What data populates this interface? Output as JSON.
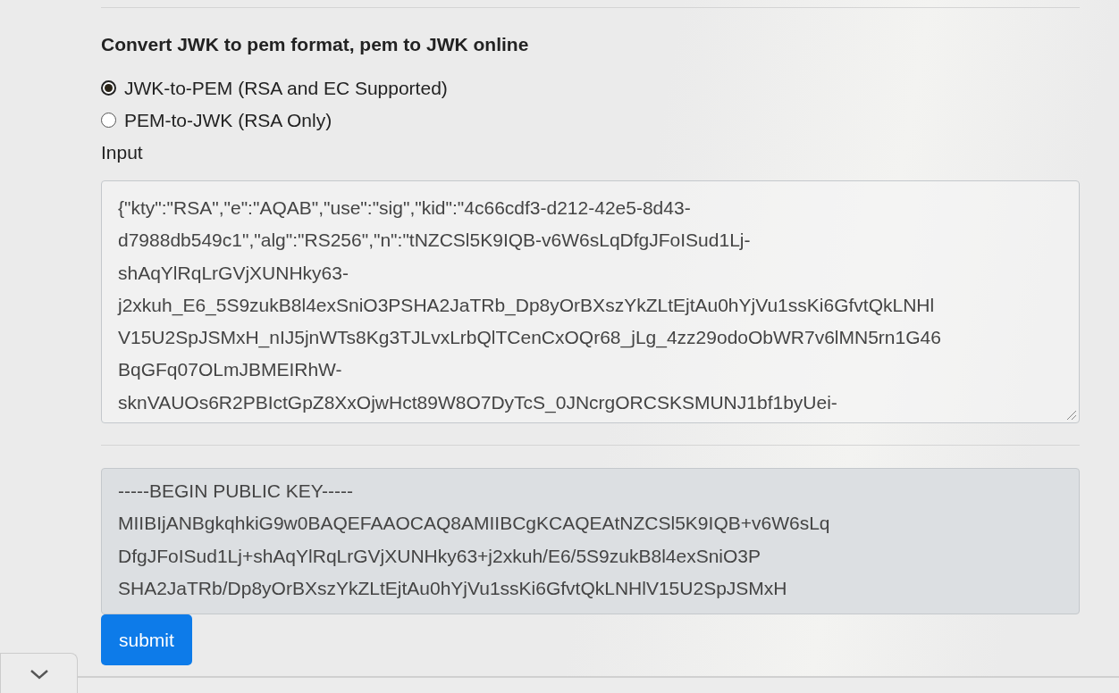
{
  "heading": "Convert JWK to pem format, pem to JWK online",
  "modes": [
    {
      "label": "JWK-to-PEM (RSA and EC Supported)",
      "selected": true
    },
    {
      "label": "PEM-to-JWK (RSA Only)",
      "selected": false
    }
  ],
  "input": {
    "label": "Input",
    "value": "{\"kty\":\"RSA\",\"e\":\"AQAB\",\"use\":\"sig\",\"kid\":\"4c66cdf3-d212-42e5-8d43-\nd7988db549c1\",\"alg\":\"RS256\",\"n\":\"tNZCSl5K9IQB-v6W6sLqDfgJFoISud1Lj-\nshAqYlRqLrGVjXUNHky63-\nj2xkuh_E6_5S9zukB8l4exSniO3PSHA2JaTRb_Dp8yOrBXszYkZLtEjtAu0hYjVu1ssKi6GfvtQkLNHl\nV15U2SpJSMxH_nIJ5jnWTs8Kg3TJLvxLrbQlTCenCxOQr68_jLg_4zz29odoObWR7v6lMN5rn1G46\nBqGFq07OLmJBMEIRhW-\nsknVAUOs6R2PBIctGpZ8XxOjwHct89W8O7DyTcS_0JNcrgORCSKSMUNJ1bf1byUei-"
  },
  "output": {
    "value": "-----BEGIN PUBLIC KEY-----\nMIIBIjANBgkqhkiG9w0BAQEFAAOCAQ8AMIIBCgKCAQEAtNZCSl5K9IQB+v6W6sLq\nDfgJFoISud1Lj+shAqYlRqLrGVjXUNHky63+j2xkuh/E6/5S9zukB8l4exSniO3P\nSHA2JaTRb/Dp8yOrBXszYkZLtEjtAu0hYjVu1ssKi6GfvtQkLNHlV15U2SpJSMxH",
    "disabled": true
  },
  "submit": "submit"
}
